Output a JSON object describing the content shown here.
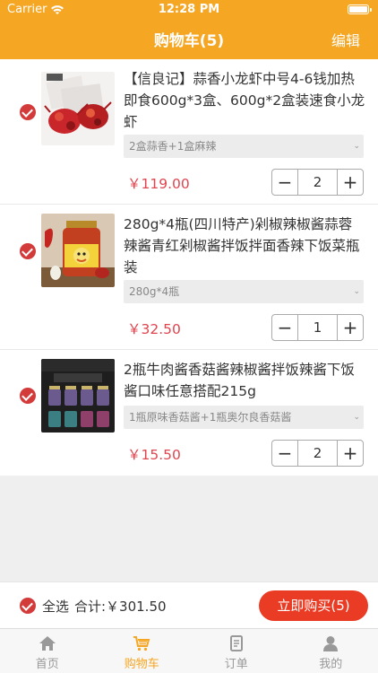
{
  "status_bar": {
    "carrier": "Carrier",
    "time": "12:28 PM"
  },
  "header": {
    "title": "购物车(5)",
    "edit_label": "编辑"
  },
  "cart_items": [
    {
      "name": "【信良记】蒜香小龙虾中号4-6钱加热即食600g*3盒、600g*2盒装速食小龙虾",
      "spec": "2盒蒜香+1盒麻辣",
      "price": "￥119.00",
      "quantity": "2",
      "selected": true
    },
    {
      "name": "280g*4瓶(四川特产)剁椒辣椒酱蒜蓉辣酱青红剁椒酱拌饭拌面香辣下饭菜瓶装",
      "spec": "280g*4瓶",
      "price": "￥32.50",
      "quantity": "1",
      "selected": true
    },
    {
      "name": "2瓶牛肉酱香菇酱辣椒酱拌饭辣酱下饭酱口味任意搭配215g",
      "spec": "1瓶原味香菇酱+1瓶奥尔良香菇酱",
      "price": "￥15.50",
      "quantity": "2",
      "selected": true
    }
  ],
  "stepper": {
    "minus": "−",
    "plus": "+"
  },
  "footer": {
    "select_all_label": "全选",
    "total_label": "合计:￥301.50",
    "buy_label": "立即购买(5)"
  },
  "tabbar": [
    {
      "label": "首页",
      "icon": "home-icon",
      "active": false
    },
    {
      "label": "购物车",
      "icon": "cart-icon",
      "active": true
    },
    {
      "label": "订单",
      "icon": "order-icon",
      "active": false
    },
    {
      "label": "我的",
      "icon": "user-icon",
      "active": false
    }
  ],
  "colors": {
    "accent": "#f5a623",
    "price": "#e0454f",
    "buy_button": "#ea3c24",
    "check": "#d33b3b"
  }
}
